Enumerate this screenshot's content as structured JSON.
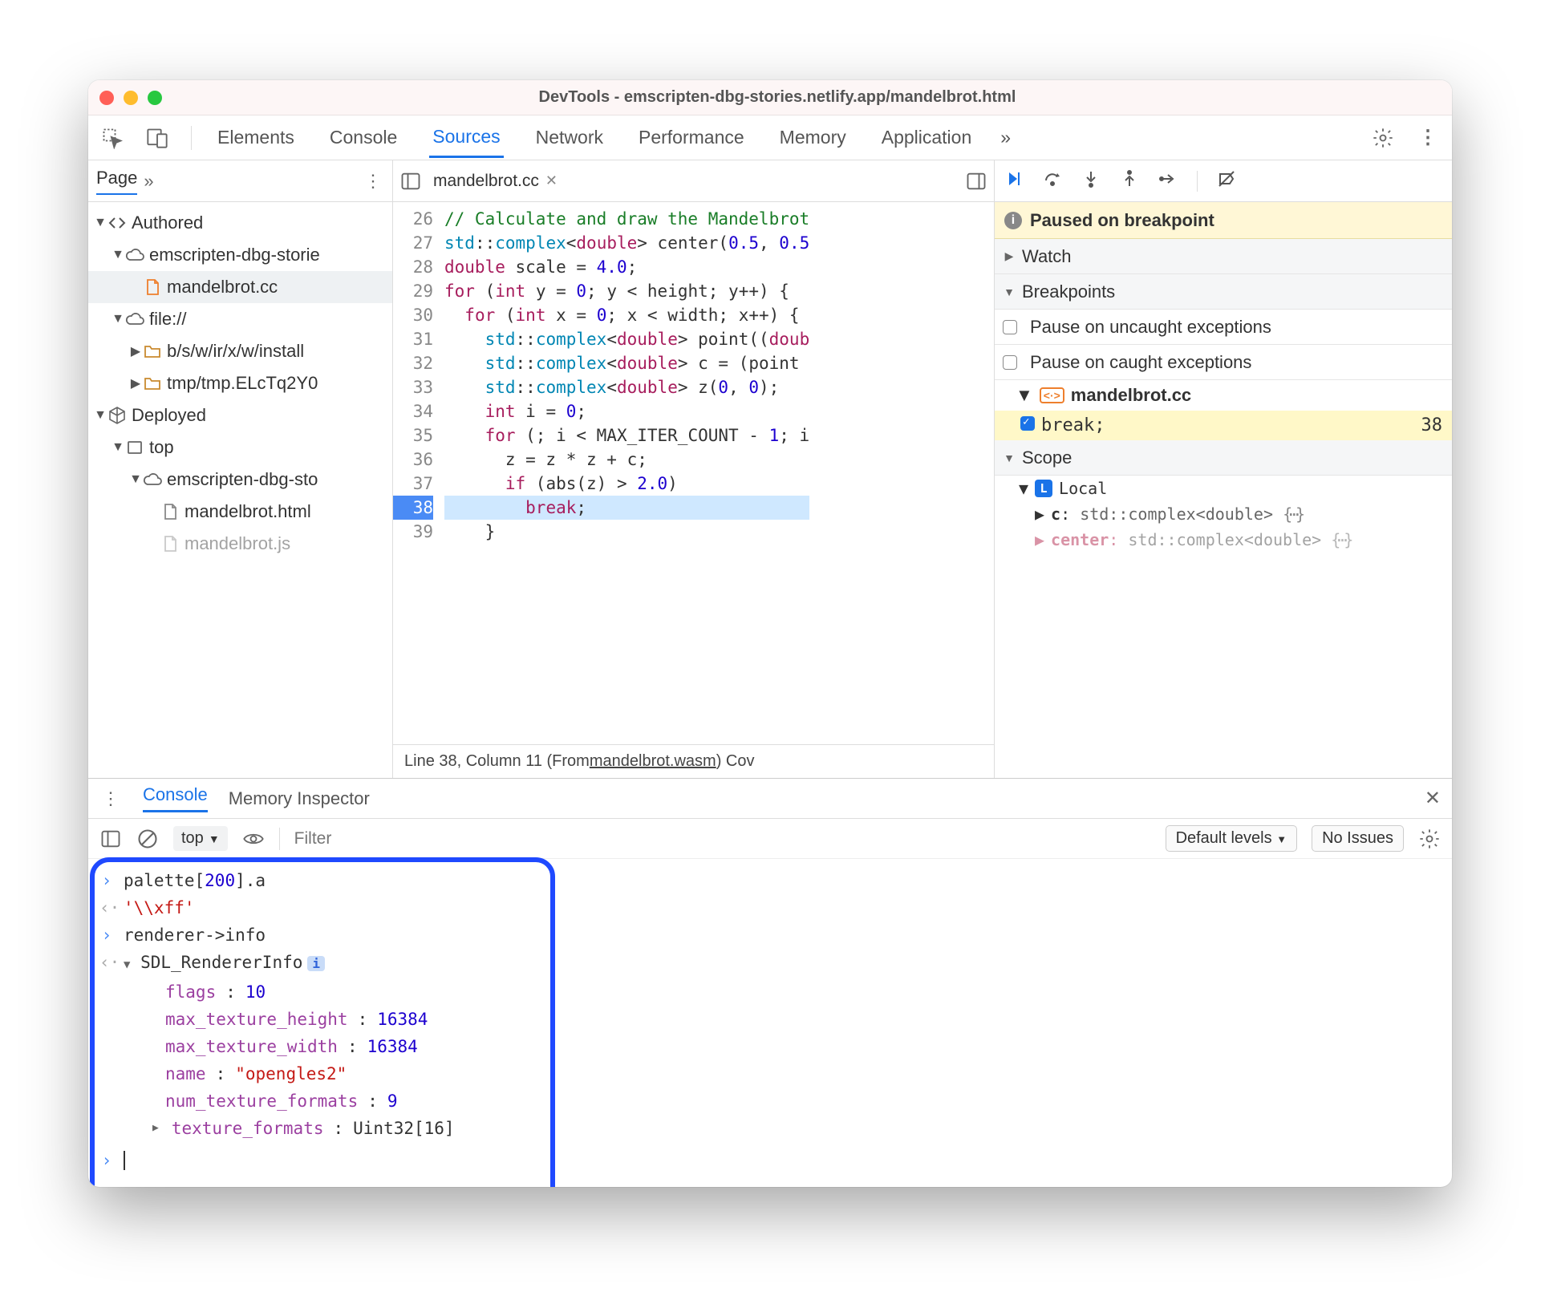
{
  "window": {
    "title": "DevTools - emscripten-dbg-stories.netlify.app/mandelbrot.html"
  },
  "tabs": {
    "items": [
      "Elements",
      "Console",
      "Sources",
      "Network",
      "Performance",
      "Memory",
      "Application"
    ],
    "active": "Sources",
    "overflow": "»"
  },
  "navigator": {
    "tabs": {
      "active": "Page",
      "overflow": "»"
    },
    "tree": [
      {
        "depth": 0,
        "collapsed": false,
        "icon": "angles",
        "label": "Authored"
      },
      {
        "depth": 1,
        "collapsed": false,
        "icon": "cloud",
        "label": "emscripten-dbg-storie"
      },
      {
        "depth": 2,
        "collapsed": true,
        "icon": "doc-orange",
        "label": "mandelbrot.cc",
        "selected": true
      },
      {
        "depth": 1,
        "collapsed": false,
        "icon": "cloud",
        "label": "file://"
      },
      {
        "depth": 2,
        "collapsed": true,
        "icon": "folder",
        "label": "b/s/w/ir/x/w/install"
      },
      {
        "depth": 2,
        "collapsed": true,
        "icon": "folder",
        "label": "tmp/tmp.ELcTq2Y0"
      },
      {
        "depth": 0,
        "collapsed": false,
        "icon": "cube",
        "label": "Deployed"
      },
      {
        "depth": 1,
        "collapsed": false,
        "icon": "frame",
        "label": "top"
      },
      {
        "depth": 2,
        "collapsed": false,
        "icon": "cloud",
        "label": "emscripten-dbg-sto"
      },
      {
        "depth": 3,
        "collapsed": true,
        "icon": "doc",
        "label": "mandelbrot.html"
      },
      {
        "depth": 3,
        "collapsed": true,
        "icon": "doc",
        "label": "mandelbrot.js",
        "dim": true
      }
    ]
  },
  "editor": {
    "tab": "mandelbrot.cc",
    "first_line": 26,
    "lines": [
      {
        "n": 26,
        "html": "<span class='cm'>// Calculate and draw the Mandelbrot</span>"
      },
      {
        "n": 27,
        "html": "<span class='ty'>std</span>::<span class='ty'>complex</span>&lt;<span class='kw'>double</span>&gt; center(<span class='num'>0.5</span>, <span class='num'>0.5</span>"
      },
      {
        "n": 28,
        "html": "<span class='kw'>double</span> scale = <span class='num'>4.0</span>;"
      },
      {
        "n": 29,
        "html": "<span class='kw'>for</span> (<span class='kw'>int</span> y = <span class='num'>0</span>; y &lt; height; y++) {"
      },
      {
        "n": 30,
        "html": "  <span class='kw'>for</span> (<span class='kw'>int</span> x = <span class='num'>0</span>; x &lt; width; x++) {"
      },
      {
        "n": 31,
        "html": "    <span class='ty'>std</span>::<span class='ty'>complex</span>&lt;<span class='kw'>double</span>&gt; point((<span class='kw'>doub</span>"
      },
      {
        "n": 32,
        "html": "    <span class='ty'>std</span>::<span class='ty'>complex</span>&lt;<span class='kw'>double</span>&gt; c = (point "
      },
      {
        "n": 33,
        "html": "    <span class='ty'>std</span>::<span class='ty'>complex</span>&lt;<span class='kw'>double</span>&gt; z(<span class='num'>0</span>, <span class='num'>0</span>);"
      },
      {
        "n": 34,
        "html": "    <span class='kw'>int</span> i = <span class='num'>0</span>;"
      },
      {
        "n": 35,
        "html": "    <span class='kw'>for</span> (; i &lt; MAX_ITER_COUNT - <span class='num'>1</span>; i"
      },
      {
        "n": 36,
        "html": "      z = z * z + c;"
      },
      {
        "n": 37,
        "html": "      <span class='kw'>if</span> (abs(z) &gt; <span class='num'>2.0</span>)"
      },
      {
        "n": 38,
        "html": "        <span class='kw'>break</span>;",
        "hl": true
      },
      {
        "n": 39,
        "html": "    }"
      }
    ],
    "status_prefix": "Line 38, Column 11 (From ",
    "status_link": "mandelbrot.wasm",
    "status_suffix": ")  Cov"
  },
  "debugger": {
    "banner": "Paused on breakpoint",
    "watch": "Watch",
    "breakpoints": {
      "header": "Breakpoints",
      "pause_uncaught": "Pause on uncaught exceptions",
      "pause_caught": "Pause on caught exceptions",
      "file": "mandelbrot.cc",
      "item_text": "break;",
      "item_line": "38"
    },
    "scope": {
      "header": "Scope",
      "local": "Local",
      "vars": [
        {
          "name": "c",
          "type": "std::complex<double>"
        },
        {
          "name": "center",
          "type": "std::complex<double>",
          "dim": true
        }
      ]
    }
  },
  "drawer": {
    "tabs": [
      "Console",
      "Memory Inspector"
    ],
    "active": "Console",
    "context": "top",
    "filter_placeholder": "Filter",
    "levels": "Default levels",
    "issues": "No Issues",
    "console": {
      "in1": "palette[200].a",
      "out1": "'\\\\xff'",
      "in2": "renderer->info",
      "out2_name": "SDL_RendererInfo",
      "props": [
        {
          "k": "flags",
          "v": "10",
          "t": "num"
        },
        {
          "k": "max_texture_height",
          "v": "16384",
          "t": "num"
        },
        {
          "k": "max_texture_width",
          "v": "16384",
          "t": "num"
        },
        {
          "k": "name",
          "v": "\"opengles2\"",
          "t": "str"
        },
        {
          "k": "num_texture_formats",
          "v": "9",
          "t": "num"
        },
        {
          "k": "texture_formats",
          "v": "Uint32[16]",
          "t": "obj",
          "expander": true
        }
      ]
    }
  }
}
